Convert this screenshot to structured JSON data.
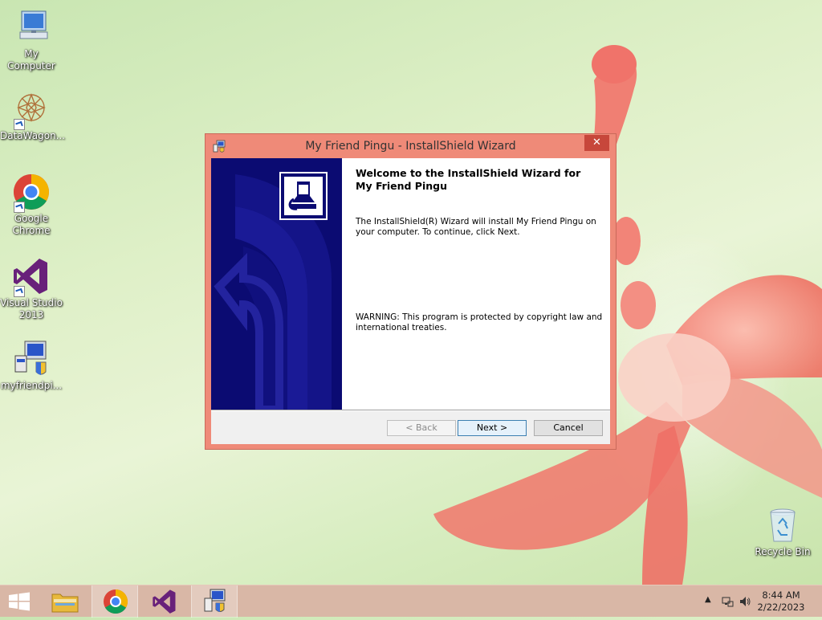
{
  "desktop": {
    "icons": [
      {
        "label": "My Computer",
        "icon": "computer-icon"
      },
      {
        "label": "DataWagon...",
        "icon": "datawagon-icon"
      },
      {
        "label": "Google Chrome",
        "icon": "chrome-icon"
      },
      {
        "label": "Visual Studio 2013",
        "icon": "visual-studio-icon"
      },
      {
        "label": "myfriendpi...",
        "icon": "installer-icon"
      },
      {
        "label": "Recycle Bin",
        "icon": "recycle-bin-icon"
      }
    ]
  },
  "wizard": {
    "title": "My Friend Pingu - InstallShield Wizard",
    "close_label": "✕",
    "heading": "Welcome to the InstallShield Wizard for My Friend Pingu",
    "description": "The InstallShield(R) Wizard will install My Friend Pingu on your computer. To continue, click Next.",
    "warning": "WARNING: This program is protected by copyright law and international treaties.",
    "buttons": {
      "back": "< Back",
      "next": "Next >",
      "cancel": "Cancel"
    }
  },
  "taskbar": {
    "items": [
      "start-icon",
      "file-explorer-icon",
      "chrome-icon",
      "visual-studio-icon",
      "installer-icon"
    ],
    "clock": {
      "time": "8:44 AM",
      "date": "2/22/2023"
    }
  },
  "colors": {
    "window_frame": "#ef8a78",
    "close_button": "#c7473b",
    "banner": "#0a0a6e",
    "taskbar": "#d9b7a6"
  }
}
